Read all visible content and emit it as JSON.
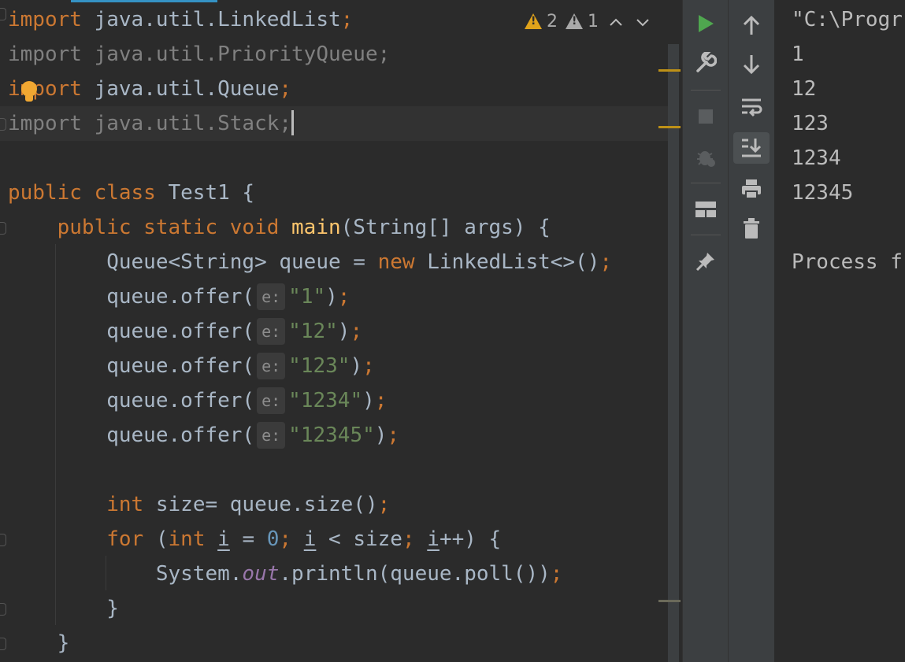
{
  "editor": {
    "lines": [
      {
        "segments": [
          {
            "t": "import",
            "c": "kw"
          },
          {
            "t": " java.util.LinkedList"
          },
          {
            "t": ";",
            "c": "kw"
          }
        ]
      },
      {
        "segments": [
          {
            "t": "import java.util.PriorityQueue;",
            "c": "dim"
          }
        ]
      },
      {
        "segments": [
          {
            "t": "import",
            "c": "kw"
          },
          {
            "t": " java.util.Queue"
          },
          {
            "t": ";",
            "c": "kw"
          }
        ]
      },
      {
        "segments": [
          {
            "t": "import java.util.Stack;",
            "c": "dim"
          },
          {
            "caret": true
          }
        ]
      },
      {
        "segments": []
      },
      {
        "segments": [
          {
            "t": "public class ",
            "c": "kw"
          },
          {
            "t": "Test1 {"
          }
        ]
      },
      {
        "segments": [
          {
            "t": "    public static void ",
            "c": "kw"
          },
          {
            "t": "main",
            "c": "fn"
          },
          {
            "t": "(String[] args) {"
          }
        ]
      },
      {
        "segments": [
          {
            "t": "        Queue<String> queue = "
          },
          {
            "t": "new ",
            "c": "kw"
          },
          {
            "t": "LinkedList<>()"
          },
          {
            "t": ";",
            "c": "kw"
          }
        ]
      },
      {
        "segments": [
          {
            "t": "        queue.offer("
          },
          {
            "hint": "e:"
          },
          {
            "t": "\"1\"",
            "c": "str"
          },
          {
            "t": ")"
          },
          {
            "t": ";",
            "c": "kw"
          }
        ]
      },
      {
        "segments": [
          {
            "t": "        queue.offer("
          },
          {
            "hint": "e:"
          },
          {
            "t": "\"12\"",
            "c": "str"
          },
          {
            "t": ")"
          },
          {
            "t": ";",
            "c": "kw"
          }
        ]
      },
      {
        "segments": [
          {
            "t": "        queue.offer("
          },
          {
            "hint": "e:"
          },
          {
            "t": "\"123\"",
            "c": "str"
          },
          {
            "t": ")"
          },
          {
            "t": ";",
            "c": "kw"
          }
        ]
      },
      {
        "segments": [
          {
            "t": "        queue.offer("
          },
          {
            "hint": "e:"
          },
          {
            "t": "\"1234\"",
            "c": "str"
          },
          {
            "t": ")"
          },
          {
            "t": ";",
            "c": "kw"
          }
        ]
      },
      {
        "segments": [
          {
            "t": "        queue.offer("
          },
          {
            "hint": "e:"
          },
          {
            "t": "\"12345\"",
            "c": "str"
          },
          {
            "t": ")"
          },
          {
            "t": ";",
            "c": "kw"
          }
        ]
      },
      {
        "segments": []
      },
      {
        "segments": [
          {
            "t": "        "
          },
          {
            "t": "int ",
            "c": "kw"
          },
          {
            "t": "size= queue.size()"
          },
          {
            "t": ";",
            "c": "kw"
          }
        ]
      },
      {
        "segments": [
          {
            "t": "        "
          },
          {
            "t": "for ",
            "c": "kw"
          },
          {
            "t": "("
          },
          {
            "t": "int ",
            "c": "kw"
          },
          {
            "t": "i",
            "c": "ul"
          },
          {
            "t": " = "
          },
          {
            "t": "0",
            "c": "num"
          },
          {
            "t": "; ",
            "c": "kw"
          },
          {
            "t": "i",
            "c": "ul"
          },
          {
            "t": " < size"
          },
          {
            "t": "; ",
            "c": "kw"
          },
          {
            "t": "i",
            "c": "ul"
          },
          {
            "t": "++) {"
          }
        ]
      },
      {
        "segments": [
          {
            "t": "            System."
          },
          {
            "t": "out",
            "c": "field"
          },
          {
            "t": ".println(queue.poll())"
          },
          {
            "t": ";",
            "c": "kw"
          }
        ]
      },
      {
        "segments": [
          {
            "t": "        }"
          }
        ]
      },
      {
        "segments": [
          {
            "t": "    }"
          }
        ]
      }
    ]
  },
  "inspections": {
    "warnings": "2",
    "weak_warnings": "1"
  },
  "console": {
    "lines": [
      "\"C:\\Progr",
      "1",
      "12",
      "123",
      "1234",
      "12345",
      "",
      "Process f"
    ]
  },
  "colors": {
    "keyword": "#cc7832",
    "string": "#6a8759",
    "number": "#6897bb",
    "function": "#ffc66d",
    "warning": "#e0a31b",
    "run": "#4fa74f"
  }
}
